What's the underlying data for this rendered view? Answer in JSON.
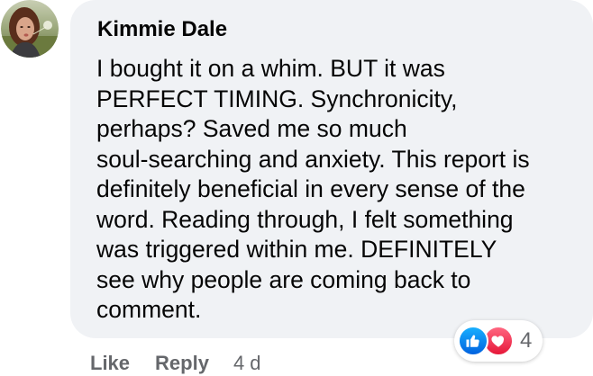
{
  "comment": {
    "author": "Kimmie Dale",
    "text": "I bought it on a whim. BUT it was\nPERFECT TIMING. Synchronicity,\nperhaps? Saved me so much\nsoul-searching and anxiety. This report is\ndefinitely beneficial in every sense of the\nword. Reading through, I felt something\nwas triggered within me. DEFINITELY\nsee why people are coming back to\ncomment.",
    "avatar_icon": "profile-photo"
  },
  "reactions": {
    "icons": [
      "like-reaction-icon",
      "love-reaction-icon"
    ],
    "count": "4",
    "colors": {
      "like": "#1877f2",
      "love": "#f33e58"
    }
  },
  "actions": {
    "like_label": "Like",
    "reply_label": "Reply",
    "timestamp": "4 d"
  },
  "colors": {
    "bubble": "#f0f2f5",
    "text": "#050505",
    "secondary_text": "#65676b"
  }
}
